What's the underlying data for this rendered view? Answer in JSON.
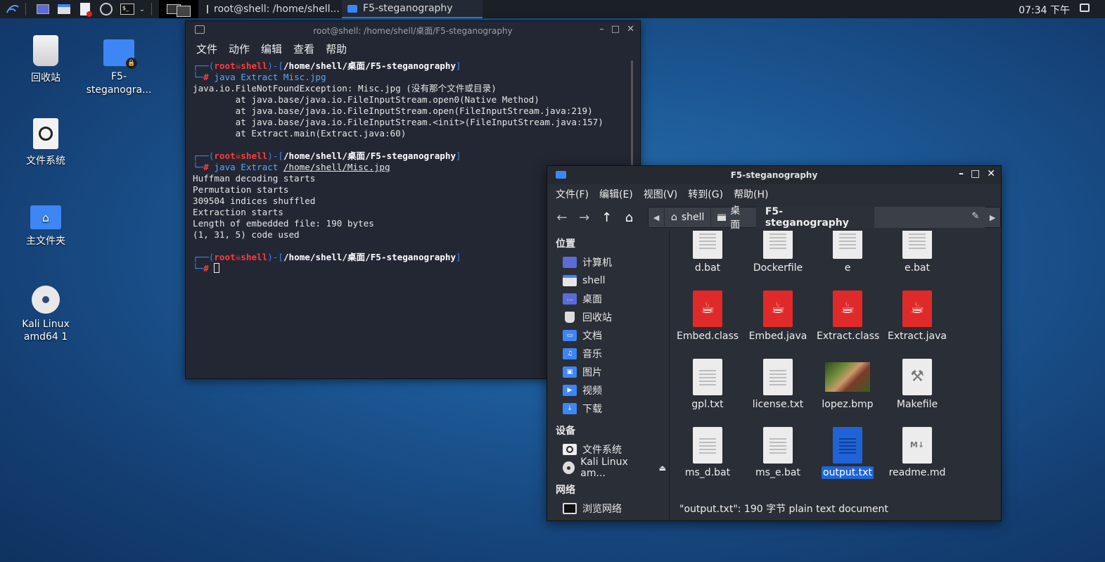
{
  "panel": {
    "tasks": [
      {
        "label": "root@shell: /home/shell..."
      },
      {
        "label": "F5-steganography"
      }
    ],
    "clock": "07:34 下午"
  },
  "desktop": {
    "icons": [
      {
        "label": "回收站"
      },
      {
        "label": "F5-steganogra..."
      },
      {
        "label": "文件系统"
      },
      {
        "label": "主文件夹"
      },
      {
        "label": "Kali Linux amd64 1"
      }
    ]
  },
  "terminal": {
    "title": "root@shell: /home/shell/桌面/F5-steganography",
    "menu": [
      "文件",
      "动作",
      "编辑",
      "查看",
      "帮助"
    ],
    "prompt": {
      "user": "root",
      "host": "shell",
      "path": "/home/shell/桌面/F5-steganography"
    },
    "cmd1": "java Extract Misc.jpg",
    "out1": [
      "java.io.FileNotFoundException: Misc.jpg (没有那个文件或目录)",
      "        at java.base/java.io.FileInputStream.open0(Native Method)",
      "        at java.base/java.io.FileInputStream.open(FileInputStream.java:219)",
      "        at java.base/java.io.FileInputStream.<init>(FileInputStream.java:157)",
      "        at Extract.main(Extract.java:60)"
    ],
    "cmd2_prefix": "java Extract ",
    "cmd2_arg": "/home/shell/Misc.jpg",
    "out2": [
      "Huffman decoding starts",
      "Permutation starts",
      "309504 indices shuffled",
      "Extraction starts",
      "Length of embedded file: 190 bytes",
      "(1, 31, 5) code used"
    ]
  },
  "filemanager": {
    "title": "F5-steganography",
    "menu": [
      "文件(F)",
      "编辑(E)",
      "视图(V)",
      "转到(G)",
      "帮助(H)"
    ],
    "crumbs": [
      "shell",
      "桌面",
      "F5-steganography"
    ],
    "sidebar": {
      "places_title": "位置",
      "places": [
        "计算机",
        "shell",
        "桌面",
        "回收站",
        "文档",
        "音乐",
        "图片",
        "视频",
        "下载"
      ],
      "devices_title": "设备",
      "devices": [
        "文件系统",
        "Kali Linux am..."
      ],
      "network_title": "网络",
      "network": [
        "浏览网络"
      ]
    },
    "files": [
      {
        "name": "d.bat",
        "kind": "txt"
      },
      {
        "name": "Dockerfile",
        "kind": "txt"
      },
      {
        "name": "e",
        "kind": "txt"
      },
      {
        "name": "e.bat",
        "kind": "txt"
      },
      {
        "name": "Embed.class",
        "kind": "java"
      },
      {
        "name": "Embed.java",
        "kind": "java"
      },
      {
        "name": "Extract.class",
        "kind": "java"
      },
      {
        "name": "Extract.java",
        "kind": "java"
      },
      {
        "name": "gpl.txt",
        "kind": "txt"
      },
      {
        "name": "license.txt",
        "kind": "txt"
      },
      {
        "name": "lopez.bmp",
        "kind": "image"
      },
      {
        "name": "Makefile",
        "kind": "make"
      },
      {
        "name": "ms_d.bat",
        "kind": "txt"
      },
      {
        "name": "ms_e.bat",
        "kind": "txt"
      },
      {
        "name": "output.txt",
        "kind": "blue",
        "selected": true
      },
      {
        "name": "readme.md",
        "kind": "md"
      }
    ],
    "status": "\"output.txt\": 190 字节 plain text document"
  }
}
